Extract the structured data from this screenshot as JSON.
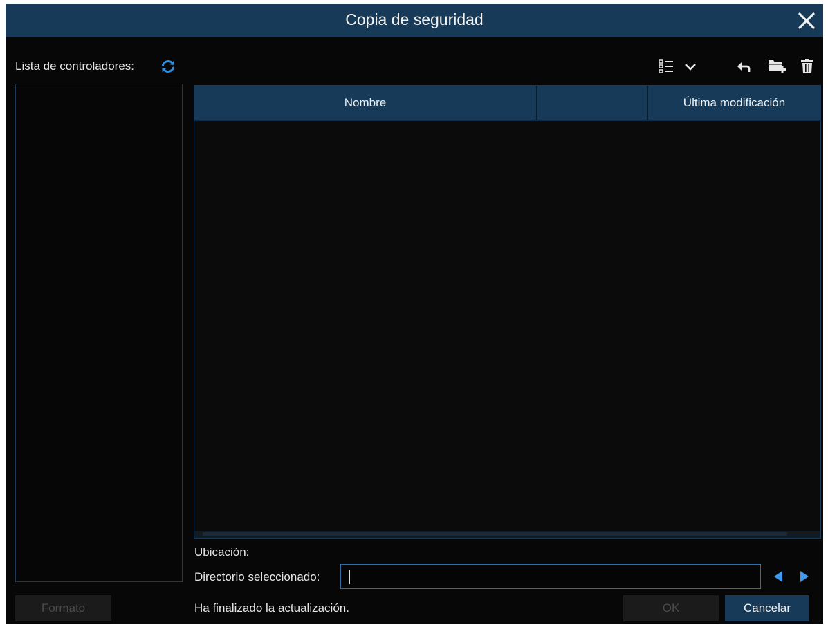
{
  "window": {
    "title": "Copia de seguridad",
    "close_icon": "close-icon"
  },
  "drivers": {
    "label": "Lista de controladores:",
    "refresh_icon": "refresh-icon",
    "items": []
  },
  "toolbar": {
    "icons": [
      "list-view-icon",
      "chevron-down-icon",
      "back-arrow-icon",
      "new-folder-icon",
      "trash-icon"
    ]
  },
  "table": {
    "columns": [
      "Nombre",
      "",
      "Última modificación"
    ],
    "rows": []
  },
  "location": {
    "label": "Ubicación:",
    "value": ""
  },
  "directory": {
    "label": "Directorio seleccionado:",
    "value": ""
  },
  "status": {
    "text": "Ha finalizado la actualización."
  },
  "buttons": {
    "format": "Formato",
    "ok": "OK",
    "cancel": "Cancelar"
  },
  "colors": {
    "accent": "#163a58",
    "accent_text": "#2f8fe0",
    "background": "#070707",
    "border": "#1c3a55"
  }
}
